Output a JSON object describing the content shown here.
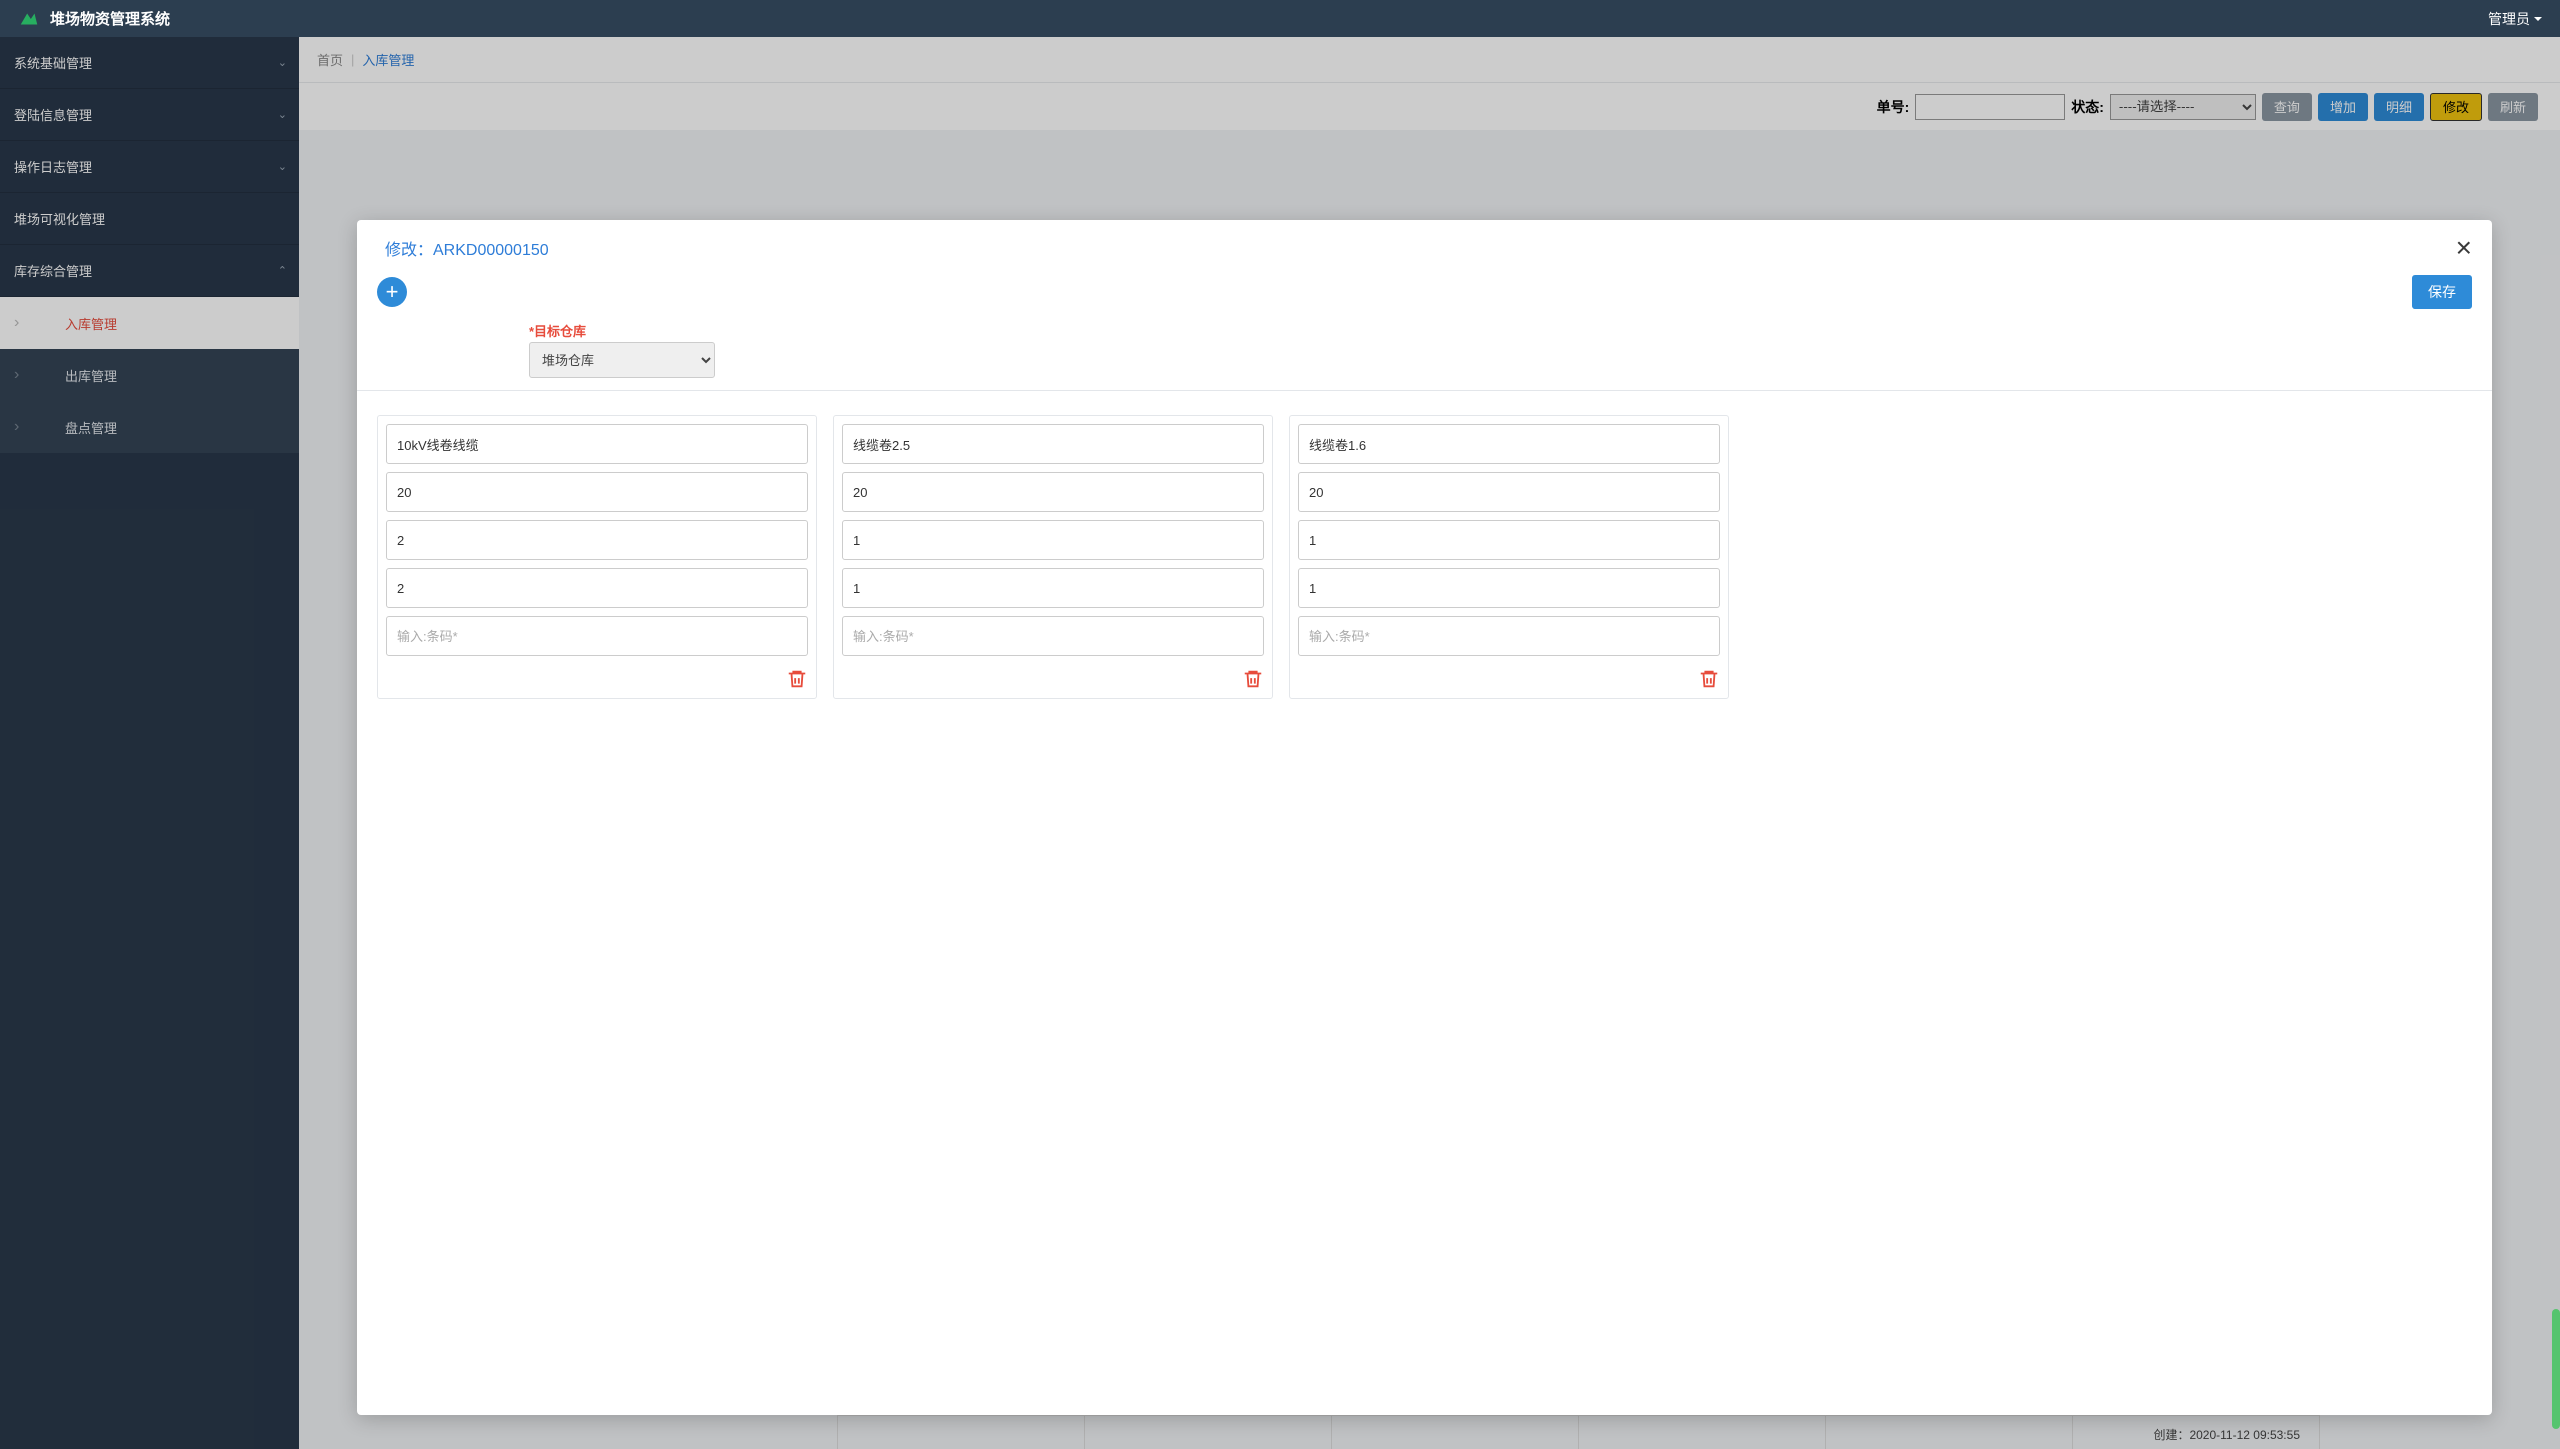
{
  "header": {
    "app_title": "堆场物资管理系统",
    "user_label": "管理员"
  },
  "sidebar": {
    "items": [
      {
        "label": "系统基础管理",
        "expandable": true,
        "open": false
      },
      {
        "label": "登陆信息管理",
        "expandable": true,
        "open": false
      },
      {
        "label": "操作日志管理",
        "expandable": true,
        "open": false
      },
      {
        "label": "堆场可视化管理",
        "expandable": false
      },
      {
        "label": "库存综合管理",
        "expandable": true,
        "open": true
      }
    ],
    "subitems": [
      {
        "label": "入库管理",
        "active": true
      },
      {
        "label": "出库管理",
        "active": false
      },
      {
        "label": "盘点管理",
        "active": false
      }
    ]
  },
  "breadcrumb": {
    "home": "首页",
    "current": "入库管理"
  },
  "toolbar": {
    "order_label": "单号:",
    "status_label": "状态:",
    "status_placeholder": "----请选择----",
    "query": "查询",
    "add": "增加",
    "detail": "明细",
    "modify": "修改",
    "refresh": "刷新"
  },
  "modal": {
    "title": "修改：ARKD00000150",
    "save": "保存",
    "target_label": "*目标仓库",
    "target_value": "堆场仓库",
    "barcode_placeholder": "输入:条码*",
    "cards": [
      {
        "name": "10kV线卷线缆",
        "f1": "20",
        "f2": "2",
        "f3": "2"
      },
      {
        "name": "线缆卷2.5",
        "f1": "20",
        "f2": "1",
        "f3": "1"
      },
      {
        "name": "线缆卷1.6",
        "f1": "20",
        "f2": "1",
        "f3": "1"
      }
    ]
  },
  "footer": {
    "created": "创建：2020-11-12 09:53:55"
  }
}
